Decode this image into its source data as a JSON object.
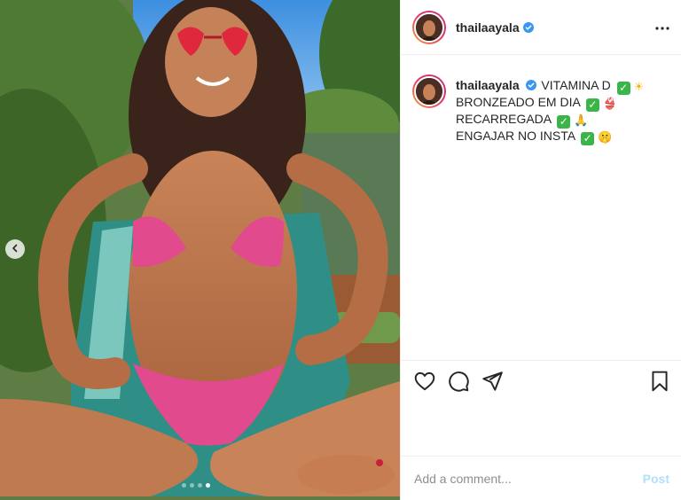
{
  "post": {
    "username": "thailaayala",
    "verified": true,
    "caption": {
      "lines": [
        {
          "text": "VITAMINA D",
          "emojis": [
            "check",
            "sun"
          ]
        },
        {
          "text": "BRONZEADO EM DIA",
          "emojis": [
            "check",
            "bikini"
          ]
        },
        {
          "text": "RECARREGADA",
          "emojis": [
            "check",
            "pray"
          ]
        },
        {
          "text": "ENGAJAR NO INSTA",
          "emojis": [
            "check",
            "shushing-face"
          ]
        }
      ]
    },
    "carousel": {
      "total": 4,
      "active_index": 3
    },
    "comment": {
      "placeholder": "Add a comment...",
      "submit_label": "Post"
    }
  },
  "icons": {
    "more": "more-options-icon",
    "like": "heart-icon",
    "comment": "comment-icon",
    "share": "paper-plane-icon",
    "save": "bookmark-icon",
    "prev": "chevron-left-icon",
    "verified": "verified-badge-icon"
  },
  "colors": {
    "verified": "#3897f0",
    "post_button_disabled": "#b2dffc",
    "text": "#262626",
    "muted": "#8e8e8e",
    "divider": "#efefef"
  }
}
